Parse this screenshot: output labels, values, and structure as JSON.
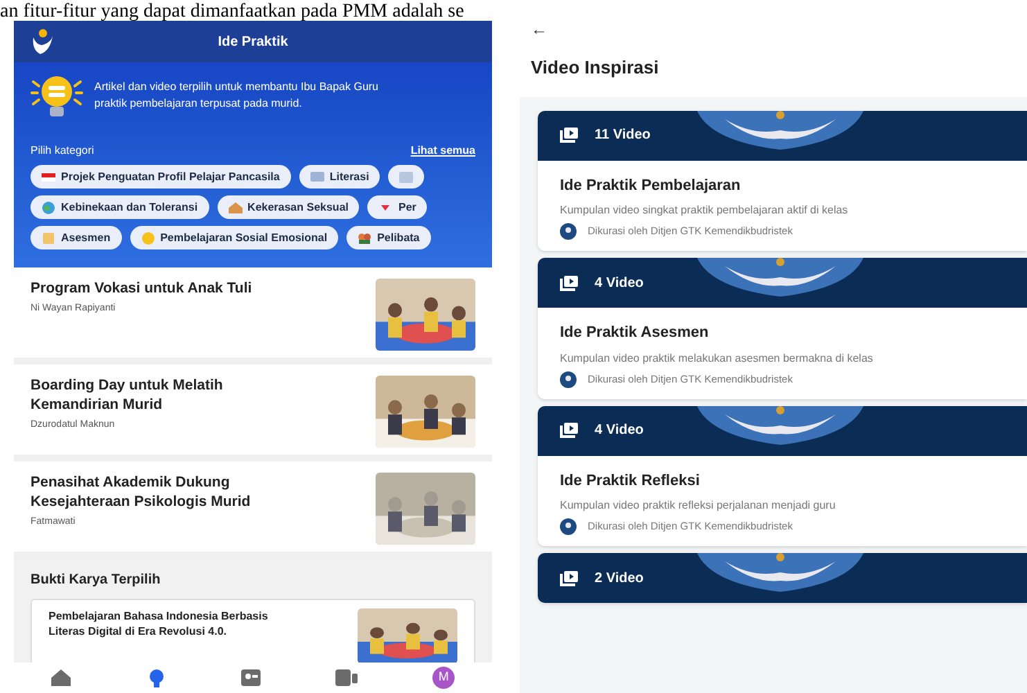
{
  "document_text": "an fitur-fitur yang dapat dimanfaatkan pada PMM adalah se",
  "ide_praktik": {
    "title": "Ide Praktik",
    "intro": "Artikel dan video terpilih untuk membantu Ibu Bapak Guru praktik pembelajaran terpusat pada murid.",
    "category_label": "Pilih kategori",
    "see_all": "Lihat semua",
    "chip_rows": [
      [
        {
          "label": "Projek Penguatan Profil Pelajar Pancasila"
        },
        {
          "label": "Literasi"
        },
        {}
      ],
      [
        {
          "label": "Kebinekaan dan Toleransi"
        },
        {
          "label": "Kekerasan Seksual"
        },
        {
          "label": "Per"
        }
      ],
      [
        {
          "label": "Asesmen"
        },
        {
          "label": "Pembelajaran Sosial Emosional"
        },
        {
          "label": "Pelibata"
        }
      ]
    ],
    "articles": [
      {
        "title": "Program Vokasi untuk Anak Tuli",
        "author": "Ni Wayan Rapiyanti",
        "kind": "picture"
      },
      {
        "title": "Boarding Day untuk Melatih Kemandirian Murid",
        "author": "Dzurodatul Maknun",
        "kind": "picture"
      },
      {
        "title": "Penasihat Akademik Dukung Kesejahteraan Psikologis Murid",
        "author": "Fatmawati",
        "kind": "picture"
      }
    ],
    "featured": {
      "heading": "Bukti Karya Terpilih",
      "card_title": "Pembelajaran Bahasa Indonesia Berbasis Literas Digital di Era Revolusi 4.0."
    },
    "nav": [
      {
        "kind": "home",
        "selected": false
      },
      {
        "kind": "idea",
        "selected": true
      },
      {
        "kind": "community",
        "selected": false
      },
      {
        "kind": "video",
        "selected": false
      },
      {
        "kind": "avatar",
        "selected": false,
        "initial": "M"
      }
    ]
  },
  "video_inspirasi": {
    "back": "←",
    "title": "Video Inspirasi",
    "cards": [
      {
        "count": "11 Video",
        "title": "Ide Praktik Pembelajaran",
        "description": "Kumpulan video singkat praktik pembelajaran aktif di kelas",
        "curator": "Dikurasi oleh Ditjen GTK Kemendikbudristek"
      },
      {
        "count": "4 Video",
        "title": "Ide Praktik Asesmen",
        "description": "Kumpulan video praktik melakukan asesmen bermakna di kelas",
        "curator": "Dikurasi oleh Ditjen GTK Kemendikbudristek"
      },
      {
        "count": "4 Video",
        "title": "Ide Praktik Refleksi",
        "description": "Kumpulan video praktik refleksi perjalanan menjadi guru",
        "curator": "Dikurasi oleh Ditjen GTK Kemendikbudristek"
      },
      {
        "count": "2 Video"
      }
    ]
  }
}
